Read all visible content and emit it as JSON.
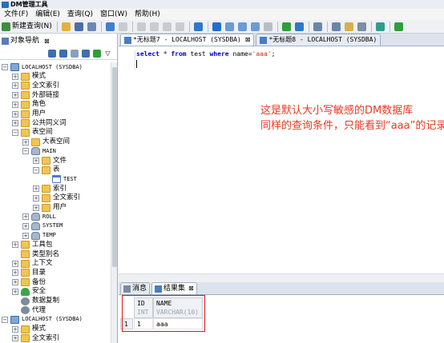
{
  "window": {
    "title": "DM管理工具"
  },
  "menu": [
    "文件(F)",
    "编辑(E)",
    "查询(Q)",
    "窗口(W)",
    "帮助(H)"
  ],
  "toolbar": {
    "new_query_label": "新建查询(N)"
  },
  "navigator": {
    "tab_label": "对象导航",
    "tree": [
      {
        "label": "LOCALHOST (SYSDBA)",
        "level": 0,
        "expander": "-",
        "icon": "server-icon",
        "mono": true
      },
      {
        "label": "模式",
        "level": 1,
        "expander": "+",
        "icon": "folder-icon"
      },
      {
        "label": "全文索引",
        "level": 1,
        "expander": "+",
        "icon": "folder-icon"
      },
      {
        "label": "外部链接",
        "level": 1,
        "expander": "+",
        "icon": "folder-icon"
      },
      {
        "label": "角色",
        "level": 1,
        "expander": "+",
        "icon": "folder-icon"
      },
      {
        "label": "用户",
        "level": 1,
        "expander": "+",
        "icon": "folder-icon"
      },
      {
        "label": "公共同义词",
        "level": 1,
        "expander": "+",
        "icon": "folder-icon"
      },
      {
        "label": "表空间",
        "level": 1,
        "expander": "-",
        "icon": "folder-icon"
      },
      {
        "label": "大表空间",
        "level": 2,
        "expander": "+",
        "icon": "folder-icon"
      },
      {
        "label": "MAIN",
        "level": 2,
        "expander": "-",
        "icon": "database-icon",
        "mono": true
      },
      {
        "label": "文件",
        "level": 3,
        "expander": "+",
        "icon": "folder-icon"
      },
      {
        "label": "表",
        "level": 3,
        "expander": "-",
        "icon": "folder-icon"
      },
      {
        "label": "TEST",
        "level": 4,
        "expander": "",
        "icon": "table-icon",
        "mono": true
      },
      {
        "label": "索引",
        "level": 3,
        "expander": "+",
        "icon": "folder-icon"
      },
      {
        "label": "全文索引",
        "level": 3,
        "expander": "+",
        "icon": "folder-icon"
      },
      {
        "label": "用户",
        "level": 3,
        "expander": "+",
        "icon": "folder-icon"
      },
      {
        "label": "ROLL",
        "level": 2,
        "expander": "+",
        "icon": "database-icon",
        "mono": true
      },
      {
        "label": "SYSTEM",
        "level": 2,
        "expander": "+",
        "icon": "database-icon",
        "mono": true
      },
      {
        "label": "TEMP",
        "level": 2,
        "expander": "+",
        "icon": "database-icon",
        "mono": true
      },
      {
        "label": "工具包",
        "level": 1,
        "expander": "+",
        "icon": "folder-icon"
      },
      {
        "label": "类型别名",
        "level": 1,
        "expander": "",
        "icon": "folder-icon"
      },
      {
        "label": "上下文",
        "level": 1,
        "expander": "+",
        "icon": "folder-icon"
      },
      {
        "label": "目录",
        "level": 1,
        "expander": "+",
        "icon": "folder-icon"
      },
      {
        "label": "备份",
        "level": 1,
        "expander": "+",
        "icon": "folder-icon"
      },
      {
        "label": "安全",
        "level": 1,
        "expander": "+",
        "icon": "shield-icon"
      },
      {
        "label": "数据复制",
        "level": 1,
        "expander": "",
        "icon": "gear-icon"
      },
      {
        "label": "代理",
        "level": 1,
        "expander": "",
        "icon": "gear-icon"
      },
      {
        "label": "LOCALHOST (SYSDBA)",
        "level": 0,
        "expander": "-",
        "icon": "server-icon",
        "mono": true
      },
      {
        "label": "模式",
        "level": 1,
        "expander": "+",
        "icon": "folder-icon"
      },
      {
        "label": "全文索引",
        "level": 1,
        "expander": "+",
        "icon": "folder-icon"
      }
    ]
  },
  "editor": {
    "tabs": [
      {
        "label": "*无标题7 - LOCALHOST (SYSDBA)",
        "active": true
      },
      {
        "label": "*无标题8 - LOCALHOST (SYSDBA)",
        "active": false
      }
    ],
    "sql": {
      "kw_select": "select",
      "star": " * ",
      "kw_from": "from",
      "table": " test ",
      "kw_where": "where",
      "cond": " name=",
      "literal": "'aaa'",
      "end": ";"
    },
    "note_lines": [
      "这是默认大小写敏感的DM数据库",
      "同样的查询条件，只能看到“aaa”的记录"
    ],
    "note_color": "#e53a24"
  },
  "results": {
    "tabs": [
      {
        "label": "消息",
        "active": false
      },
      {
        "label": "结果集",
        "active": true
      }
    ],
    "columns": [
      {
        "name": "ID",
        "type": "INT"
      },
      {
        "name": "NAME",
        "type": "VARCHAR(10)"
      }
    ],
    "rows": [
      {
        "num": "1",
        "cells": [
          "1",
          "aaa"
        ]
      }
    ],
    "highlight_color": "#e01515"
  }
}
